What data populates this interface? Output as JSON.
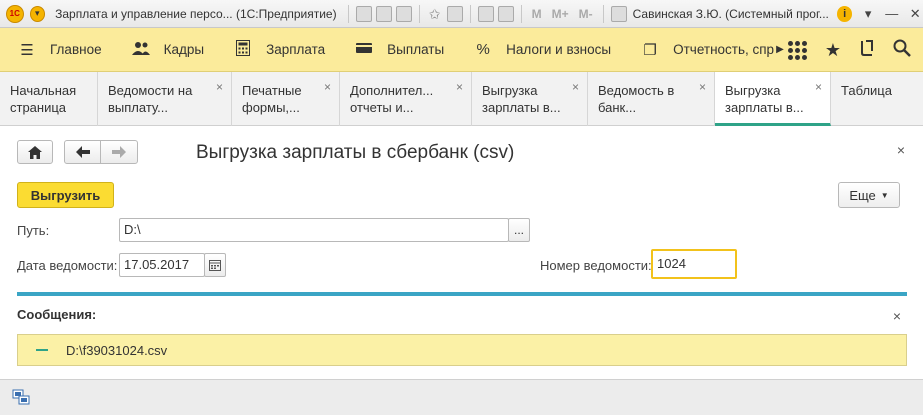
{
  "titlebar": {
    "logo_text": "1С",
    "title": "Зарплата и управление персо... (1С:Предприятие)",
    "m_buttons": [
      "M",
      "M+",
      "M-"
    ],
    "user": "Савинская З.Ю. (Системный прог...",
    "info_glyph": "i",
    "minimize": "—",
    "close": "✕"
  },
  "sections": {
    "items": [
      {
        "label": "Главное",
        "icon": "menu-icon",
        "glyph": "☰"
      },
      {
        "label": "Кадры",
        "icon": "people-icon",
        "glyph": "👥"
      },
      {
        "label": "Зарплата",
        "icon": "calculator-icon",
        "glyph": "▦"
      },
      {
        "label": "Выплаты",
        "icon": "wallet-icon",
        "glyph": "▬"
      },
      {
        "label": "Налоги и взносы",
        "icon": "percent-icon",
        "glyph": "%"
      },
      {
        "label": "Отчетность, спр",
        "icon": "reports-icon",
        "glyph": "❐"
      }
    ],
    "more_glyph": "▶"
  },
  "tabs": [
    {
      "line1": "Начальная",
      "line2": "страница",
      "closable": false
    },
    {
      "line1": "Ведомости на",
      "line2": "выплату...",
      "closable": true
    },
    {
      "line1": "Печатные",
      "line2": "формы,...",
      "closable": true
    },
    {
      "line1": "Дополнител...",
      "line2": "отчеты и...",
      "closable": true
    },
    {
      "line1": "Выгрузка",
      "line2": "зарплаты в...",
      "closable": true
    },
    {
      "line1": "Ведомость в",
      "line2": "банк...",
      "closable": true
    },
    {
      "line1": "Выгрузка",
      "line2": "зарплаты в...",
      "closable": true,
      "active": true
    },
    {
      "line1": "Таблица",
      "line2": "",
      "closable": false
    }
  ],
  "form": {
    "title": "Выгрузка зарплаты в сбербанк (csv)",
    "export_button": "Выгрузить",
    "more_button": "Еще",
    "path_label": "Путь:",
    "path_value": "D:\\",
    "browse_label": "...",
    "date_label": "Дата ведомости:",
    "date_value": "17.05.2017",
    "number_label": "Номер ведомости:",
    "number_value": "1024",
    "close_glyph": "×"
  },
  "messages": {
    "title": "Сообщения:",
    "items": [
      "D:\\f39031024.csv"
    ]
  },
  "colors": {
    "sections_bg": "#fbeb9b",
    "primary_button": "#fbdc32",
    "teal_line": "#3aa5c5",
    "message_bg": "#fbf1a6",
    "active_tab_accent": "#2fa388"
  }
}
